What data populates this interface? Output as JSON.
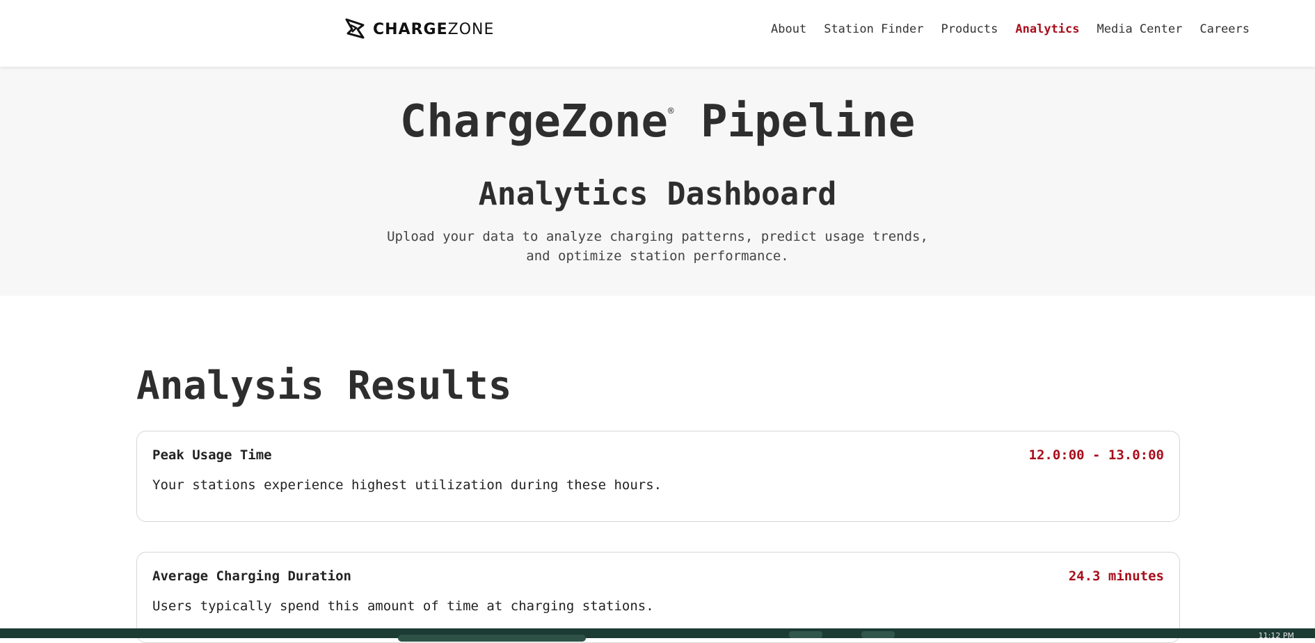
{
  "header": {
    "logo_bold": "CHARGE",
    "logo_light": "ZONE",
    "nav": [
      {
        "label": "About",
        "active": false
      },
      {
        "label": "Station Finder",
        "active": false
      },
      {
        "label": "Products",
        "active": false
      },
      {
        "label": "Analytics",
        "active": true
      },
      {
        "label": "Media Center",
        "active": false
      },
      {
        "label": "Careers",
        "active": false
      }
    ]
  },
  "hero": {
    "title_brand": "ChargeZone",
    "title_reg": "®",
    "title_rest": " Pipeline",
    "subtitle": "Analytics Dashboard",
    "description": "Upload your data to analyze charging patterns, predict usage trends, and optimize station performance."
  },
  "results": {
    "heading": "Analysis Results",
    "cards": [
      {
        "label": "Peak Usage Time",
        "value": "12.0:00 - 13.0:00",
        "description": "Your stations experience highest utilization during these hours."
      },
      {
        "label": "Average Charging Duration",
        "value": "24.3 minutes",
        "description": "Users typically spend this amount of time at charging stations."
      }
    ]
  },
  "colors": {
    "accent": "#a80e1c",
    "hero_bg": "#f7f7f7",
    "taskbar": "#1b3b33"
  },
  "taskbar": {
    "clock": "11:12 PM"
  }
}
